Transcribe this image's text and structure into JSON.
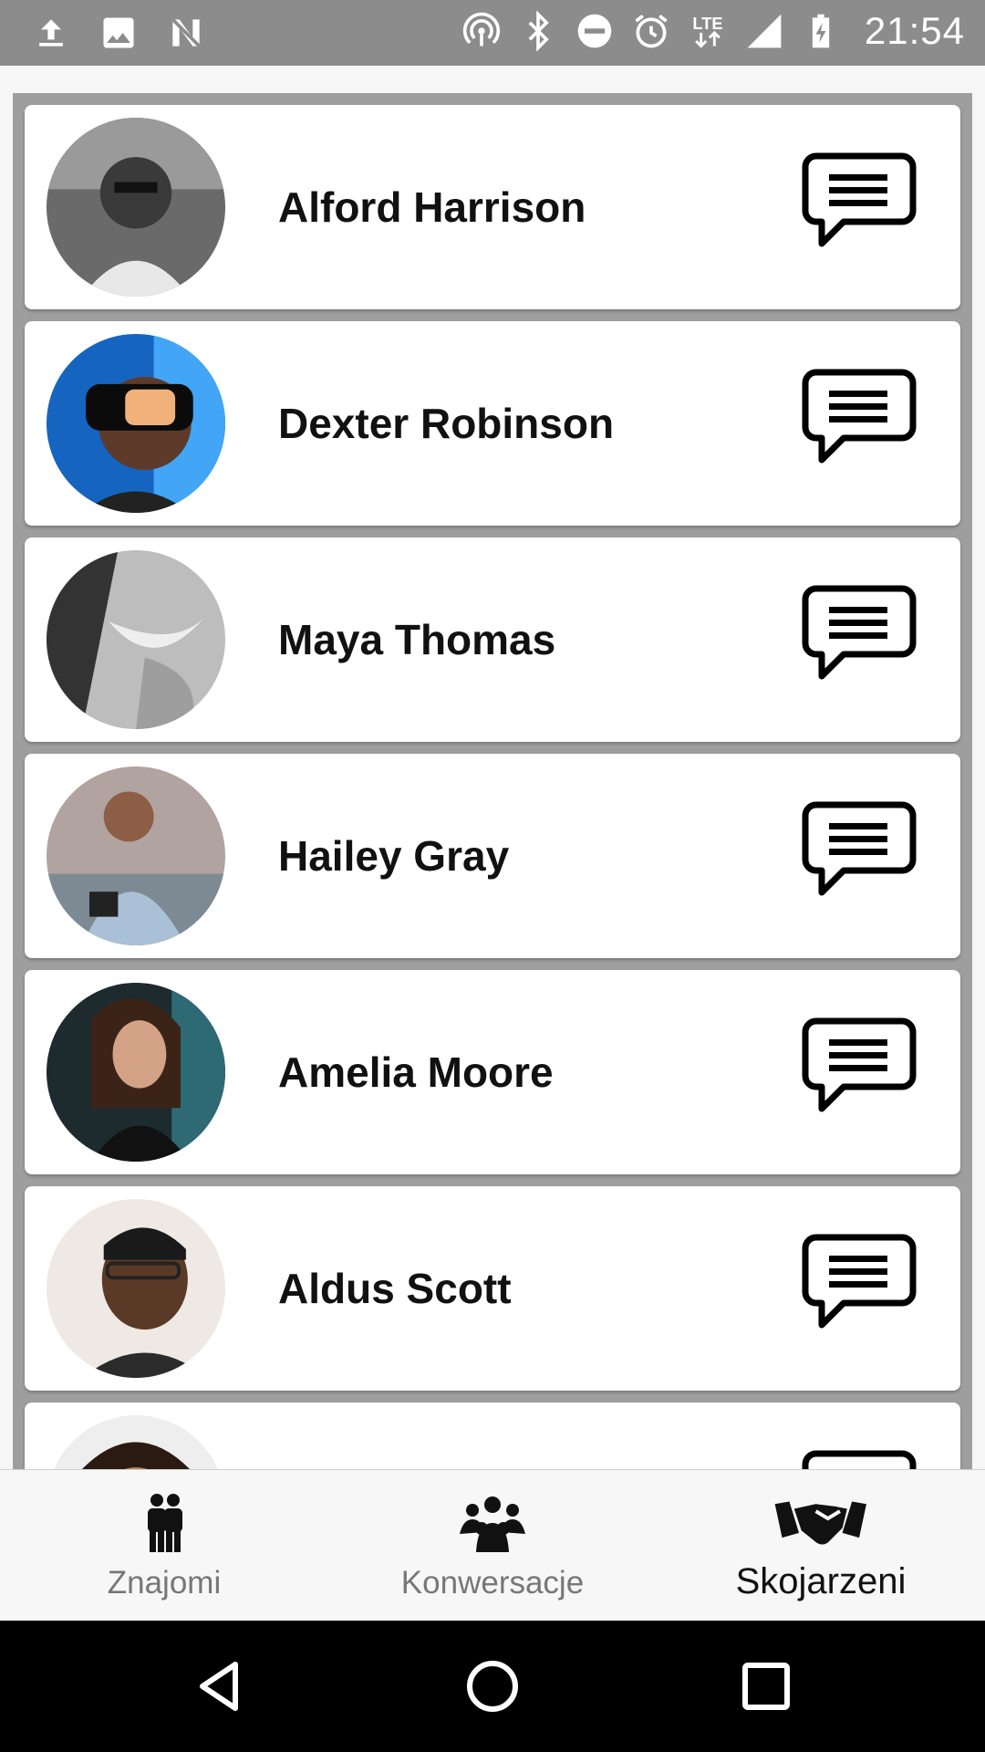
{
  "status_bar": {
    "time": "21:54",
    "network": "LTE",
    "left_icons": [
      "upload-icon",
      "image-icon",
      "n-icon"
    ],
    "right_icons": [
      "hotspot-icon",
      "bluetooth-icon",
      "do-not-disturb-icon",
      "alarm-icon",
      "lte-icon",
      "signal-icon",
      "battery-charging-icon"
    ]
  },
  "contacts": [
    {
      "name": "Alford Harrison",
      "avatar": "avatar-photo"
    },
    {
      "name": "Dexter Robinson",
      "avatar": "avatar-photo"
    },
    {
      "name": "Maya Thomas",
      "avatar": "avatar-photo"
    },
    {
      "name": "Hailey Gray",
      "avatar": "avatar-photo"
    },
    {
      "name": "Amelia Moore",
      "avatar": "avatar-photo"
    },
    {
      "name": "Aldus Scott",
      "avatar": "avatar-photo"
    },
    {
      "name": "",
      "avatar": "avatar-photo"
    }
  ],
  "bottom_nav": {
    "items": [
      {
        "label": "Znajomi",
        "icon": "friends-icon",
        "active": false
      },
      {
        "label": "Konwersacje",
        "icon": "group-icon",
        "active": false
      },
      {
        "label": "Skojarzeni",
        "icon": "handshake-icon",
        "active": true
      }
    ]
  },
  "colors": {
    "status_bar": "#8c8c8c",
    "list_frame": "#9e9e9e",
    "card": "#ffffff",
    "nav_bg": "#f7f7f7",
    "nav_inactive": "#777777",
    "nav_active": "#111111",
    "system_bar": "#000000"
  }
}
